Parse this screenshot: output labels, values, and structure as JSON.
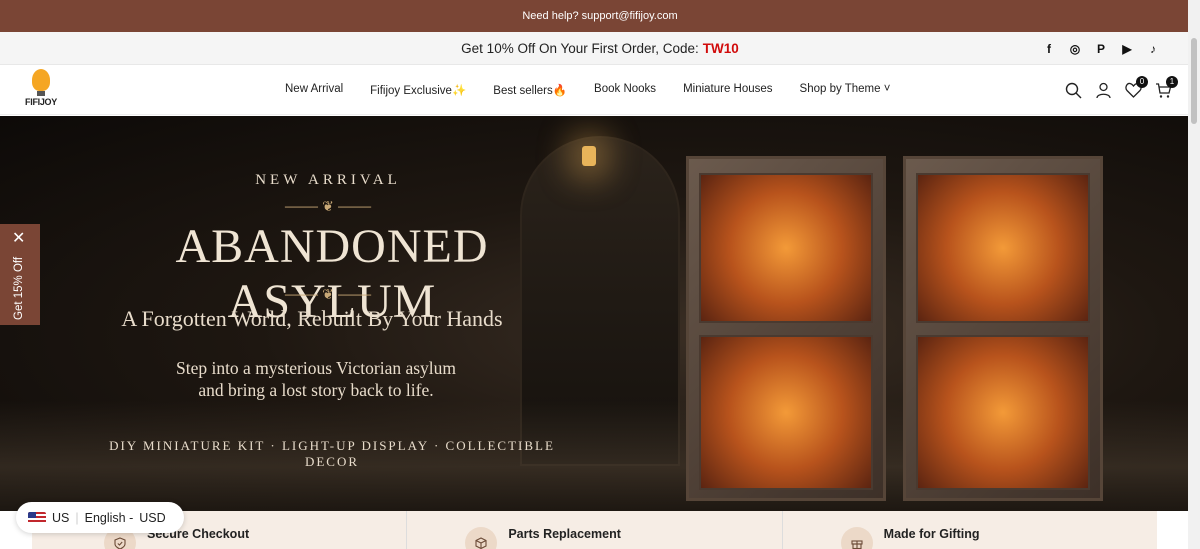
{
  "topbar": {
    "text": "Need help? support@fifijoy.com"
  },
  "promo": {
    "text": "Get 10% Off On Your First Order, Code:",
    "code": "TW10"
  },
  "socials": [
    "f",
    "◎",
    "P",
    "▶",
    "♪"
  ],
  "logo": {
    "name": "FIFIJOY"
  },
  "nav": [
    {
      "label": "New Arrival"
    },
    {
      "label": "Fifijoy Exclusive✨"
    },
    {
      "label": "Best sellers🔥"
    },
    {
      "label": "Book Nooks"
    },
    {
      "label": "Miniature Houses"
    },
    {
      "label": "Shop by Theme ˅"
    }
  ],
  "header_icons": {
    "wishlist_count": "0",
    "cart_count": "1"
  },
  "hero": {
    "eyebrow": "NEW ARRIVAL",
    "ornament": "⸻ ❦ ⸻",
    "title": "Abandoned Asylum",
    "subtitle": "A Forgotten World, Rebuilt By Your Hands",
    "body_line1": "Step into a mysterious Victorian asylum",
    "body_line2": "and bring a lost story back to life.",
    "features": "DIY MINIATURE KIT · LIGHT-UP DISPLAY · COLLECTIBLE DECOR"
  },
  "sidetab": {
    "label": "Get 15% Off",
    "close": "✕"
  },
  "features": [
    {
      "label": "Secure Checkout",
      "icon": "shield-icon"
    },
    {
      "label": "Parts Replacement",
      "icon": "box-icon"
    },
    {
      "label": "Made for Gifting",
      "icon": "gift-icon"
    }
  ],
  "locale": {
    "country": "US",
    "language": "English -",
    "currency": "USD"
  },
  "colors": {
    "brand": "#7a4535",
    "promo_code": "#d10b0b",
    "feature_bg": "#f6ede5"
  }
}
